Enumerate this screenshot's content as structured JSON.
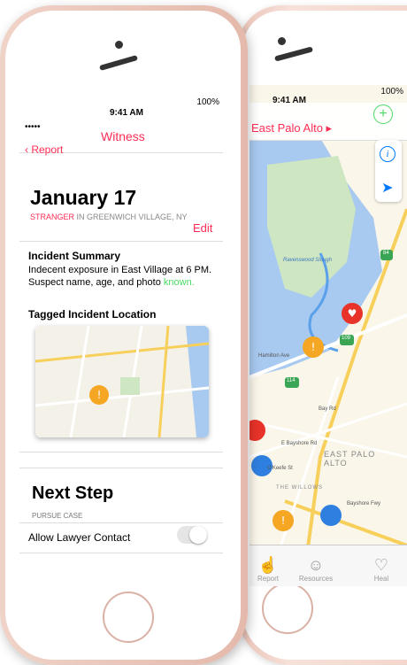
{
  "map_screen": {
    "status": {
      "time": "9:41 AM",
      "battery": "100%"
    },
    "title": "East Palo Alto ▸",
    "add_icon": "plus-circle-icon",
    "info_icon": "info-icon",
    "location_icon": "location-arrow-icon",
    "labels": {
      "ravenswood": "Ravenswood Slough",
      "hamilton": "Hamilton Ave",
      "bay_rd": "Bay Rd",
      "bayshore": "E Bayshore Rd",
      "o_keefe": "O'Keefe St",
      "willows": "THE WILLOWS",
      "epa": "EAST PALO ALTO",
      "bayshore_fwy": "Bayshore Fwy"
    },
    "route_labels": {
      "r84": "84",
      "r109": "109",
      "r114": "114"
    },
    "tabs": [
      {
        "label": "Report",
        "icon": "hand-icon"
      },
      {
        "label": "Resources",
        "icon": "people-icon"
      },
      {
        "label": "Heal",
        "icon": "heart-icon"
      }
    ]
  },
  "witness_screen": {
    "status": {
      "dots": "•••••",
      "time": "9:41 AM",
      "battery": "100%"
    },
    "back_label": "Report",
    "nav_title": "Witness",
    "date": "January 17",
    "sub_highlight": "STRANGER",
    "sub_rest": " IN GREENWICH VILLAGE, NY",
    "edit": "Edit",
    "summary_heading": "Incident Summary",
    "summary_text": "Indecent exposure in East Village at 6 PM. Suspect name, age, and photo",
    "summary_known": "known.",
    "tagged_heading": "Tagged Incident Location",
    "next_heading": "Next Step",
    "pursue": "PURSUE CASE",
    "lawyer_label": "Allow Lawyer Contact",
    "lawyer_toggle": "off"
  },
  "colors": {
    "accent": "#ff2d55",
    "green": "#4cd964",
    "blue": "#007aff",
    "orange": "#f5a623",
    "rose_gold": "#e8bfb2"
  }
}
